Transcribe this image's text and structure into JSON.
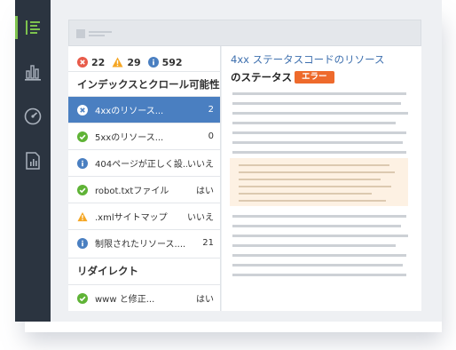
{
  "counts": {
    "errors": "22",
    "warnings": "29",
    "info": "592"
  },
  "sections": {
    "indexing": "インデックスとクロール可能性",
    "redirects": "リダイレクト"
  },
  "rows": [
    {
      "label": "4xxのリソース...",
      "value": "2",
      "icon": "error-icon",
      "selected": true
    },
    {
      "label": "5xxのリソース...",
      "value": "0",
      "icon": "check-icon"
    },
    {
      "label": "404ページが正しく設...",
      "value": "いいえ",
      "icon": "info-icon"
    },
    {
      "label": "robot.txtファイル",
      "value": "はい",
      "icon": "check-icon"
    },
    {
      "label": ".xmlサイトマップ",
      "value": "いいえ",
      "icon": "warning-icon"
    },
    {
      "label": "制限されたリソース....",
      "value": "21",
      "icon": "info-icon"
    }
  ],
  "redirect_rows": [
    {
      "label": "www と修正...",
      "value": "はい",
      "icon": "check-icon"
    }
  ],
  "detail": {
    "title": "4xx ステータスコードのリソース",
    "subtitle": "のステータス",
    "badge": "エラー"
  },
  "colors": {
    "rail": "#2b3440",
    "active": "#7dc24e",
    "selected_row": "#4a7fc1",
    "error": "#e85b4a",
    "warning": "#f5a623",
    "info": "#4a7fc1",
    "ok": "#5fb336",
    "badge": "#ee6a2c",
    "title": "#3d6fae"
  }
}
